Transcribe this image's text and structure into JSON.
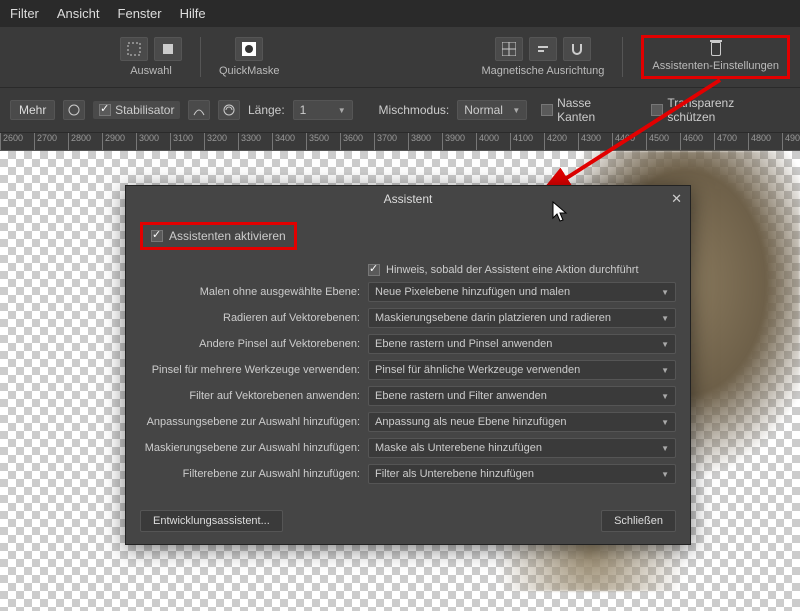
{
  "menu": {
    "items": [
      "Filter",
      "Ansicht",
      "Fenster",
      "Hilfe"
    ]
  },
  "toolbar": {
    "groups": [
      {
        "label": "Auswahl"
      },
      {
        "label": "QuickMaske"
      },
      {
        "label": "Magnetische Ausrichtung"
      },
      {
        "label": "Assistenten-Einstellungen"
      }
    ]
  },
  "toolbar2": {
    "mehr": "Mehr",
    "stabilisator": "Stabilisator",
    "laenge_label": "Länge:",
    "laenge_value": "1",
    "misch_label": "Mischmodus:",
    "misch_value": "Normal",
    "nasse": "Nasse Kanten",
    "transparenz": "Transparenz schützen"
  },
  "ruler": {
    "start": 2600,
    "step": 100,
    "count": 25
  },
  "dialog": {
    "title": "Assistent",
    "activate": "Assistenten aktivieren",
    "hint": "Hinweis, sobald der Assistent eine Aktion durchführt",
    "rows": [
      {
        "label": "Malen ohne ausgewählte Ebene:",
        "value": "Neue Pixelebene hinzufügen und malen"
      },
      {
        "label": "Radieren auf Vektorebenen:",
        "value": "Maskierungsebene darin platzieren und radieren"
      },
      {
        "label": "Andere Pinsel auf Vektorebenen:",
        "value": "Ebene rastern und Pinsel anwenden"
      },
      {
        "label": "Pinsel für mehrere Werkzeuge verwenden:",
        "value": "Pinsel für ähnliche Werkzeuge verwenden"
      },
      {
        "label": "Filter auf Vektorebenen anwenden:",
        "value": "Ebene rastern und Filter anwenden"
      },
      {
        "label": "Anpassungsebene zur Auswahl hinzufügen:",
        "value": "Anpassung als neue Ebene hinzufügen"
      },
      {
        "label": "Maskierungsebene zur Auswahl hinzufügen:",
        "value": "Maske als Unterebene hinzufügen"
      },
      {
        "label": "Filterebene zur Auswahl hinzufügen:",
        "value": "Filter als Unterebene hinzufügen"
      }
    ],
    "dev_assist": "Entwicklungsassistent...",
    "close": "Schließen"
  }
}
